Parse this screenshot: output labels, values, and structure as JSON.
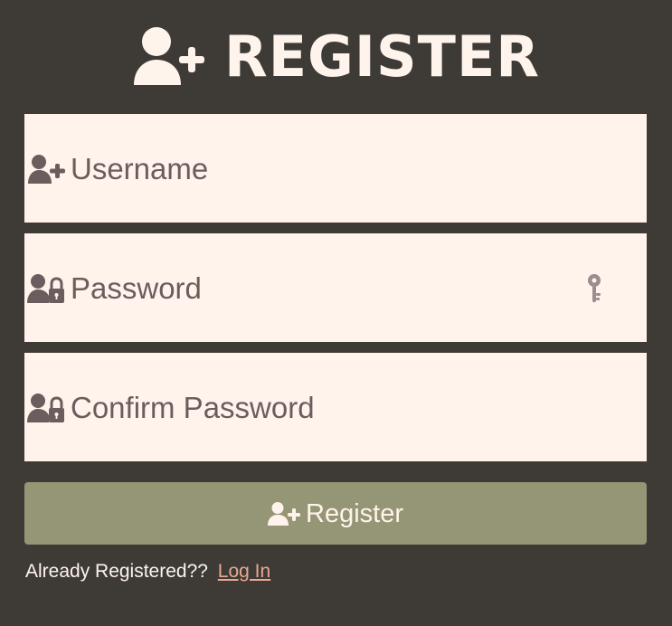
{
  "header": {
    "title": "REGISTER",
    "icon": "user-plus-icon"
  },
  "fields": {
    "username": {
      "placeholder": "Username",
      "icon": "user-plus-icon"
    },
    "password": {
      "placeholder": "Password",
      "icon": "user-lock-icon",
      "toggle_icon": "key-icon"
    },
    "confirm_password": {
      "placeholder": "Confirm Password",
      "icon": "user-lock-icon"
    }
  },
  "register_button": {
    "label": "Register",
    "icon": "user-plus-icon"
  },
  "footer": {
    "text": "Already Registered??",
    "link_label": "Log In"
  },
  "colors": {
    "background": "#3e3b37",
    "field_background": "#fff3ec",
    "field_text": "#6b5d5e",
    "button_background": "#959676",
    "link": "#e7a990",
    "header_text": "#fff4ec"
  }
}
